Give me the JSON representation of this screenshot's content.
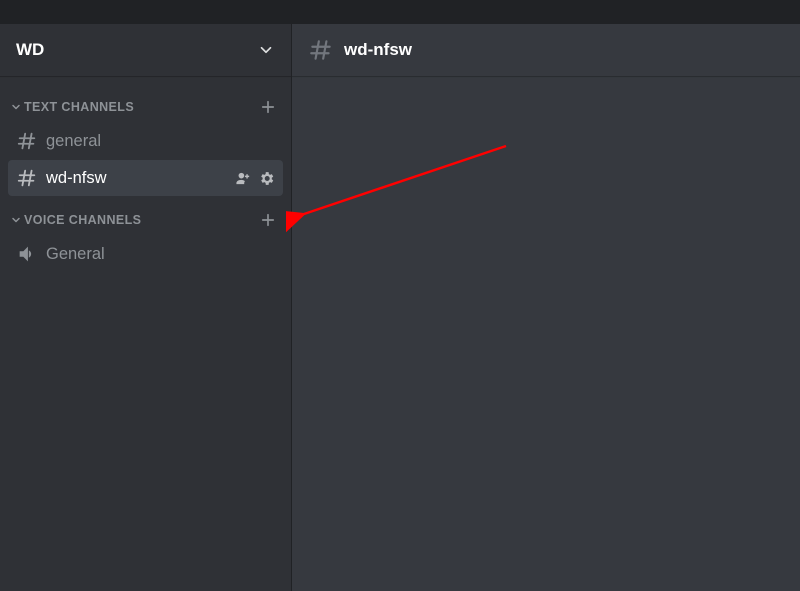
{
  "server": {
    "name": "WD"
  },
  "sidebar": {
    "categories": [
      {
        "label": "TEXT CHANNELS",
        "channels": [
          {
            "name": "general",
            "type": "text",
            "active": false
          },
          {
            "name": "wd-nfsw",
            "type": "text",
            "active": true
          }
        ]
      },
      {
        "label": "VOICE CHANNELS",
        "channels": [
          {
            "name": "General",
            "type": "voice",
            "active": false
          }
        ]
      }
    ]
  },
  "main": {
    "channel_name": "wd-nfsw"
  },
  "annotation": {
    "color": "#ff0000"
  }
}
